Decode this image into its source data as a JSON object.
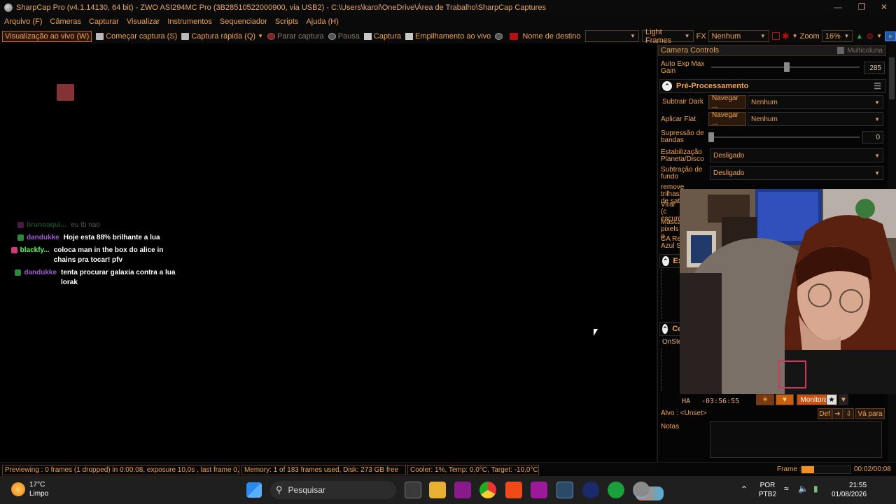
{
  "window": {
    "title": "SharpCap Pro (v4.1.14130, 64 bit) - ZWO ASI294MC Pro (3B28510522000900, via USB2) - C:\\Users\\karol\\OneDrive\\Área de Trabalho\\SharpCap Captures"
  },
  "menu": [
    "Arquivo (F)",
    "Câmeras",
    "Capturar",
    "Visualizar",
    "Instrumentos",
    "Sequenciador",
    "Scripts",
    "Ajuda (H)"
  ],
  "toolbar": {
    "live_view": "Visualização ao vivo (W)",
    "start_capture": "Começar captura (S)",
    "quick_capture": "Captura rápida (Q)",
    "stop_capture": "Parar captura",
    "pause": "Pausa",
    "capture": "Captura",
    "live_stack": "Empilhamento ao vivo",
    "target_name_label": "Nome de destino",
    "target_name_value": "",
    "frame_type": "Light Frames",
    "fx_label": "FX",
    "fx_value": "Nenhum",
    "zoom_label": "Zoom",
    "zoom_value": "16%"
  },
  "chat": [
    {
      "user": "brunoaqui...",
      "text": "eu tb nao",
      "color": "#3aa050",
      "faded": true
    },
    {
      "user": "dandukke",
      "text": "Hoje esta 88% brilhante a lua",
      "color": "#a05ad0",
      "faded": false
    },
    {
      "user": "blackfy...",
      "text": "coloca man in the box do alice in chains pra tocar! pfv",
      "color": "#5aff5a",
      "faded": false
    },
    {
      "user": "dandukke",
      "text": "tenta procurar galaxia contra a lua lorak",
      "color": "#a05ad0",
      "faded": false
    }
  ],
  "panel": {
    "camera_controls": "Camera Controls",
    "multicolumn": "Multicoluna",
    "auto_exp_label": "Auto Exp Max Gain",
    "auto_exp_value": "285",
    "preprocessing_title": "Pré-Processamento",
    "subtract_dark_label": "Subtrair Dark",
    "browse": "Navegar ...",
    "none": "Nenhum",
    "apply_flat_label": "Aplicar Flat",
    "banding_label": "Supressão de bandas",
    "banding_value": "0",
    "stabilization_label": "Estabilização Planeta/Disco",
    "off": "Desligado",
    "background_label": "Subtração de fundo",
    "remove_trails_label": "remover trilhas de saté",
    "flip_label": "Virar (c escuro",
    "mask_label": "Máscar pixels q",
    "ca_label": "CA Re Azul S",
    "ex_label": "Ex",
    "co_label": "Co",
    "onstep_label": "OnSte",
    "ha_label": "HA",
    "ha_value": "-03:56:55",
    "monitor": "Monitora",
    "target_label": "Alvo : <Unset>",
    "def_button": "Def",
    "goto_button": "Vá para",
    "notes_label": "Notas"
  },
  "status": {
    "previewing": "Previewing : 0 frames (1 dropped) in 0:00:08, exposure 10,0s , last frame 0,0s",
    "memory": "Memory: 1 of 183 frames used, Disk: 273 GB free",
    "cooler": "Cooler: 1%, Temp: 0,0°C, Target: -10,0°C",
    "frame_label": "Frame :",
    "frame_time": "00:02/00:08",
    "frame_progress": 0.25
  },
  "taskbar": {
    "temperature": "17°C",
    "weather": "Limpo",
    "search": "Pesquisar",
    "lang1": "POR",
    "lang2": "PTB2",
    "time": "21:55",
    "date": "01/08/2026"
  }
}
